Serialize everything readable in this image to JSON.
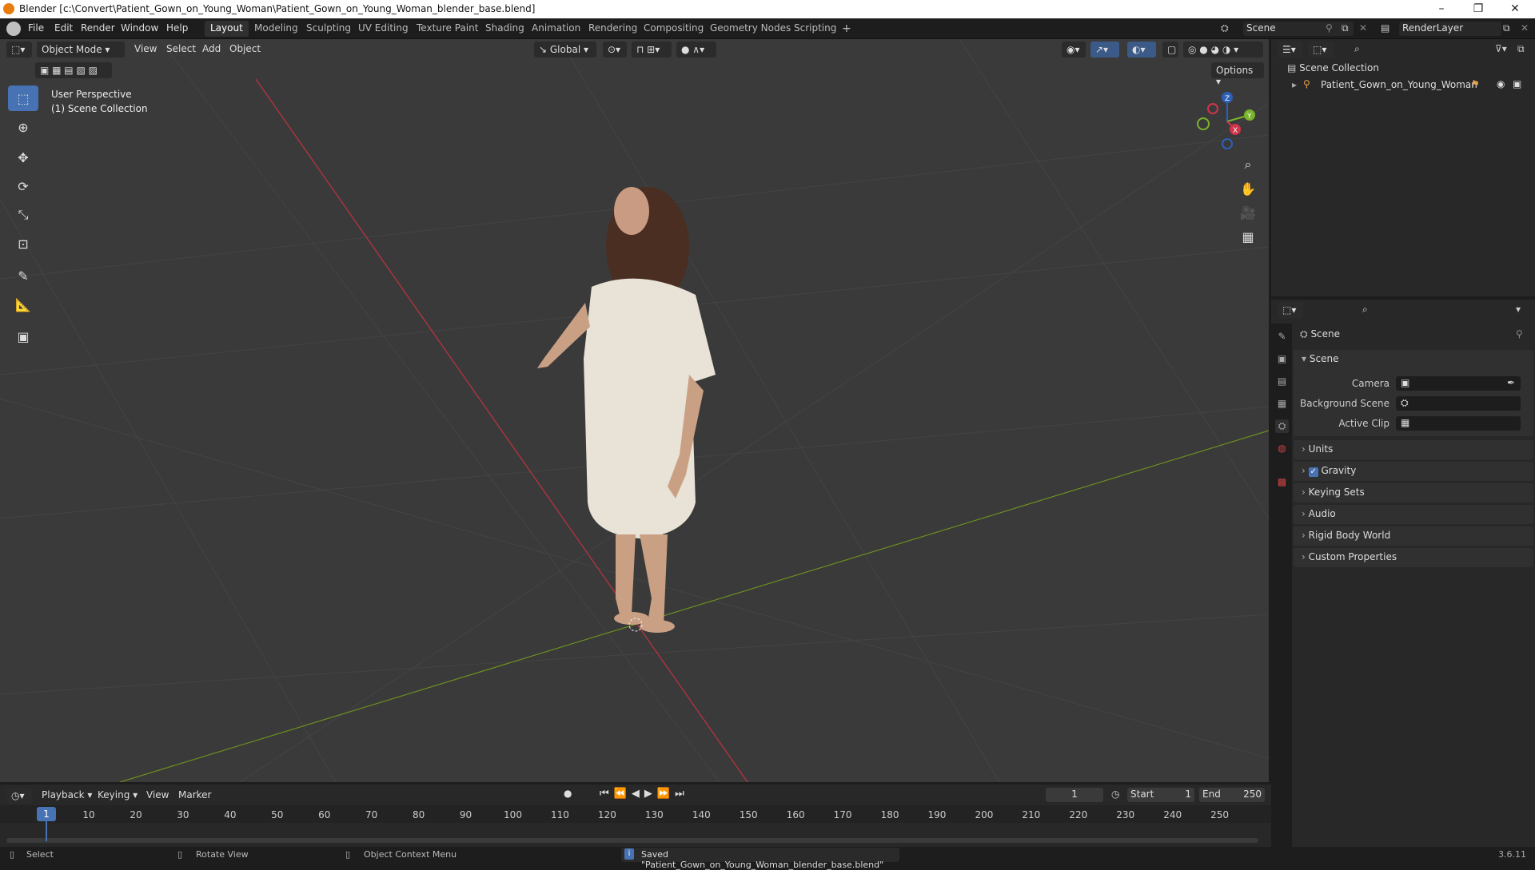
{
  "window": {
    "title": "Blender [c:\\Convert\\Patient_Gown_on_Young_Woman\\Patient_Gown_on_Young_Woman_blender_base.blend]",
    "minimize": "–",
    "maximize": "❐",
    "close": "✕"
  },
  "menu": [
    "File",
    "Edit",
    "Render",
    "Window",
    "Help"
  ],
  "workspaces": [
    {
      "label": "Layout",
      "active": true
    },
    {
      "label": "Modeling"
    },
    {
      "label": "Sculpting"
    },
    {
      "label": "UV Editing"
    },
    {
      "label": "Texture Paint"
    },
    {
      "label": "Shading"
    },
    {
      "label": "Animation"
    },
    {
      "label": "Rendering"
    },
    {
      "label": "Compositing"
    },
    {
      "label": "Geometry Nodes"
    },
    {
      "label": "Scripting"
    }
  ],
  "add_workspace": "+",
  "scene_field": "Scene",
  "renderlayer_field": "RenderLayer",
  "viewport_header": {
    "mode": "Object Mode",
    "menus": [
      "View",
      "Select",
      "Add",
      "Object"
    ],
    "transform_orientation": "Global",
    "options": "Options"
  },
  "viewport_overlay": {
    "line1": "User Perspective",
    "line2": "(1) Scene Collection"
  },
  "gizmo": {
    "x": "X",
    "y": "Y",
    "z": "Z"
  },
  "outliner": {
    "root": "Scene Collection",
    "items": [
      {
        "label": "Patient_Gown_on_Young_Woman"
      }
    ]
  },
  "properties": {
    "context": "Scene",
    "panel_title": "Scene",
    "fields": [
      {
        "label": "Camera"
      },
      {
        "label": "Background Scene"
      },
      {
        "label": "Active Clip"
      }
    ],
    "sections": [
      {
        "label": "Units"
      },
      {
        "label": "Gravity",
        "checked": true
      },
      {
        "label": "Keying Sets"
      },
      {
        "label": "Audio"
      },
      {
        "label": "Rigid Body World"
      },
      {
        "label": "Custom Properties"
      }
    ]
  },
  "timeline": {
    "menus": [
      "Playback",
      "Keying",
      "View",
      "Marker"
    ],
    "current_frame": "1",
    "start_label": "Start",
    "start": "1",
    "end_label": "End",
    "end": "250",
    "ticks": [
      "10",
      "20",
      "30",
      "40",
      "50",
      "60",
      "70",
      "80",
      "90",
      "100",
      "110",
      "120",
      "130",
      "140",
      "150",
      "160",
      "170",
      "180",
      "190",
      "200",
      "210",
      "220",
      "230",
      "240",
      "250"
    ]
  },
  "status": {
    "select": "Select",
    "rotate": "Rotate View",
    "context_menu": "Object Context Menu",
    "message": "Saved \"Patient_Gown_on_Young_Woman_blender_base.blend\"",
    "version": "3.6.11"
  }
}
